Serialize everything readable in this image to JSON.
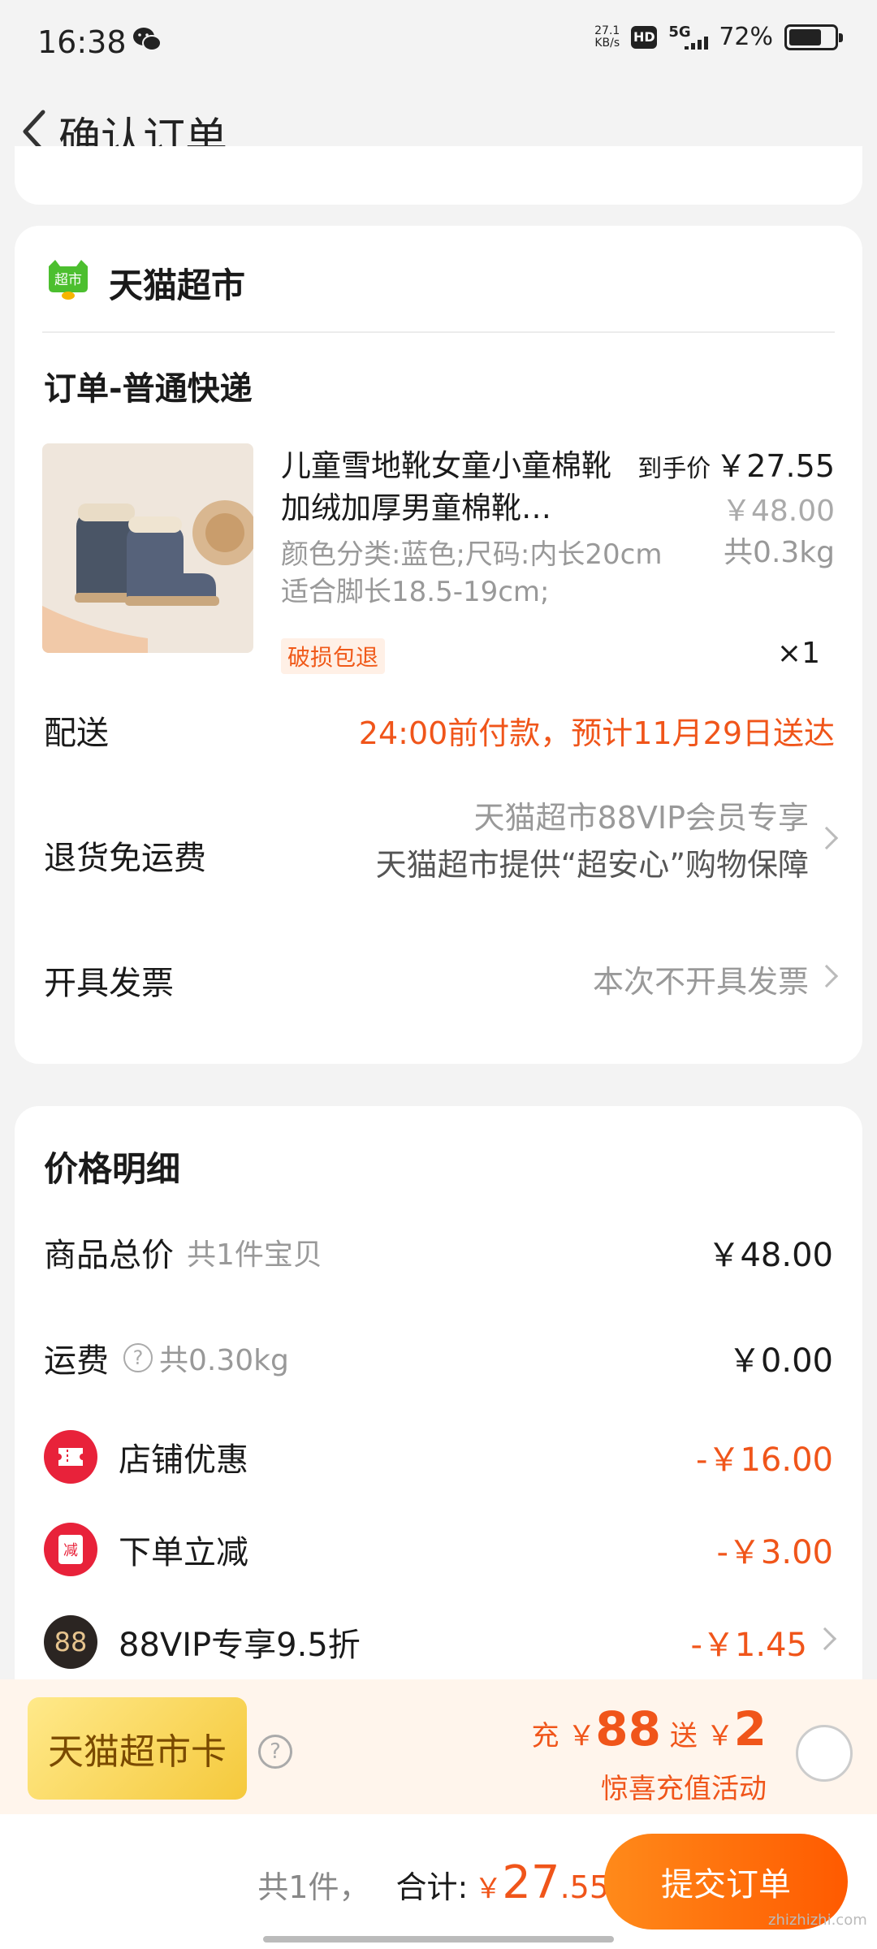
{
  "status_bar": {
    "time": "16:38",
    "net_speed_value": "27.1",
    "net_speed_unit": "KB/s",
    "hd": "HD",
    "network": "5G",
    "battery": "72%"
  },
  "header": {
    "title": "确认订单"
  },
  "store": {
    "logo_text": "超市",
    "name": "天猫超市",
    "order_type": "订单-普通快递"
  },
  "product": {
    "title": "儿童雪地靴女童小童棉靴加绒加厚男童棉靴…",
    "spec": "颜色分类:蓝色;尺码:内长20cm 适合脚长18.5-19cm;",
    "badge": "破损包退",
    "final_price_label": "到手价",
    "final_price": "￥27.55",
    "original_price": "￥48.00",
    "weight": "共0.3kg",
    "quantity": "×1"
  },
  "delivery": {
    "label": "配送",
    "value": "24:00前付款，预计11月29日送达"
  },
  "return_shipping": {
    "label": "退货免运费",
    "line1": "天猫超市88VIP会员专享",
    "line2": "天猫超市提供“超安心”购物保障"
  },
  "invoice": {
    "label": "开具发票",
    "value": "本次不开具发票"
  },
  "price_detail": {
    "title": "价格明细",
    "goods_total_label": "商品总价",
    "goods_total_sub": "共1件宝贝",
    "goods_total_value": "￥48.00",
    "shipping_label": "运费",
    "shipping_sub": "共0.30kg",
    "shipping_value": "￥0.00",
    "store_discount_label": "店铺优惠",
    "store_discount_value": "-￥16.00",
    "order_reduce_label": "下单立减",
    "order_reduce_icon": "减",
    "order_reduce_value": "-￥3.00",
    "vip_label": "88VIP专享9.5折",
    "vip_icon": "88",
    "vip_value": "-￥1.45"
  },
  "tmall_card": {
    "label": "天猫超市卡",
    "promo_charge": "充",
    "promo_charge_yen": "￥",
    "promo_charge_amount": "88",
    "promo_gift": "送",
    "promo_gift_yen": "￥",
    "promo_gift_amount": "2",
    "promo_subtitle": "惊喜充值活动"
  },
  "footer": {
    "count": "共1件，",
    "total_label": "合计:",
    "total_yen": "￥",
    "total_int": "27",
    "total_dec": ".55",
    "submit_label": "提交订单",
    "watermark": "zhizhizhi.com"
  },
  "colors": {
    "accent": "#f0551a",
    "button_start": "#ff8a1a",
    "button_end": "#ff5a00"
  }
}
